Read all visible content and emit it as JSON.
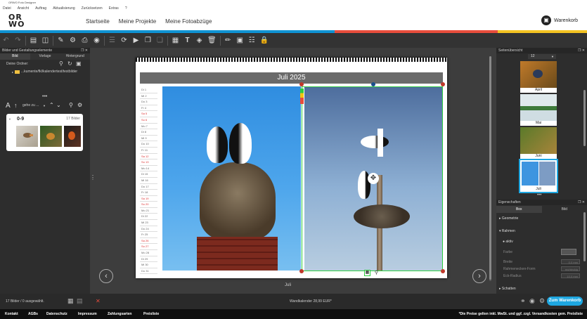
{
  "titlebar": {
    "title": "ORWO Foto Designer"
  },
  "menu": {
    "items": [
      "Datei",
      "Ansicht",
      "Auftrag",
      "Aktualisierung",
      "Zurücksetzen",
      "Extras",
      "?"
    ]
  },
  "header": {
    "logo": "OR WO",
    "nav": [
      "Startseite",
      "Meine Projekte",
      "Meine Fotoabzüge"
    ],
    "cart_label": "Warenkorb",
    "stripe_colors": [
      "#0f93d3",
      "#e84d3c",
      "#f3c322"
    ]
  },
  "left": {
    "panel_title": "Bilder und Gestaltungselemente",
    "tabs": [
      "Bild",
      "Vorlage",
      "Hintergrund"
    ],
    "folder_label": "Deine Ordner:",
    "folder_path": "...kumente/fkl/kalendertest/testbilder",
    "sort_label": "gehe zu ...",
    "group_title": "0-9",
    "group_count": "17 Bilder"
  },
  "canvas": {
    "month_title": "Juli 2025",
    "page_label": "Juli",
    "days": [
      "Di 1",
      "Mi 2",
      "Do 3",
      "Fr 4",
      "Sa 5",
      "So 6",
      "Mo 7",
      "Di 8",
      "Mi 9",
      "Do 10",
      "Fr 11",
      "Sa 12",
      "So 13",
      "Mo 14",
      "Di 15",
      "Mi 16",
      "Do 17",
      "Fr 18",
      "Sa 19",
      "So 20",
      "Mo 21",
      "Di 22",
      "Mi 23",
      "Do 24",
      "Fr 25",
      "Sa 26",
      "So 27",
      "Mo 28",
      "Di 29",
      "Mi 30",
      "Do 31"
    ]
  },
  "right": {
    "pages_title": "Seitenübersicht",
    "zoom_value": "12",
    "thumbs": [
      "April",
      "Mai",
      "Juni",
      "Juli"
    ],
    "props_title": "Eigenschaften",
    "prop_tabs": [
      "Box",
      "Bild"
    ],
    "sections": [
      "Geometrie",
      "Rahmen",
      "Schatten"
    ],
    "aktiv": "aktiv",
    "farbe": "Farbe",
    "breite": "Breite",
    "breite_val": "0,0 mm",
    "form": "Rahmenecken-Form",
    "form_val": "rechteckig",
    "radius": "Eck-Radius",
    "radius_val": "10,0 mm"
  },
  "status": {
    "count": "17 Bilder / 0 ausgewählt.",
    "product": "Wandkalender  28,99 EUR*",
    "order_button": "Zum Warenkorb"
  },
  "footer": {
    "links": [
      "Kontakt",
      "AGBs",
      "Datenschutz",
      "Impressum",
      "Zahlungsarten",
      "Preisliste"
    ],
    "notice": "*Die Preise gelten inkl. MwSt. und ggf. zzgl. Versandkosten gem. Preisliste"
  }
}
